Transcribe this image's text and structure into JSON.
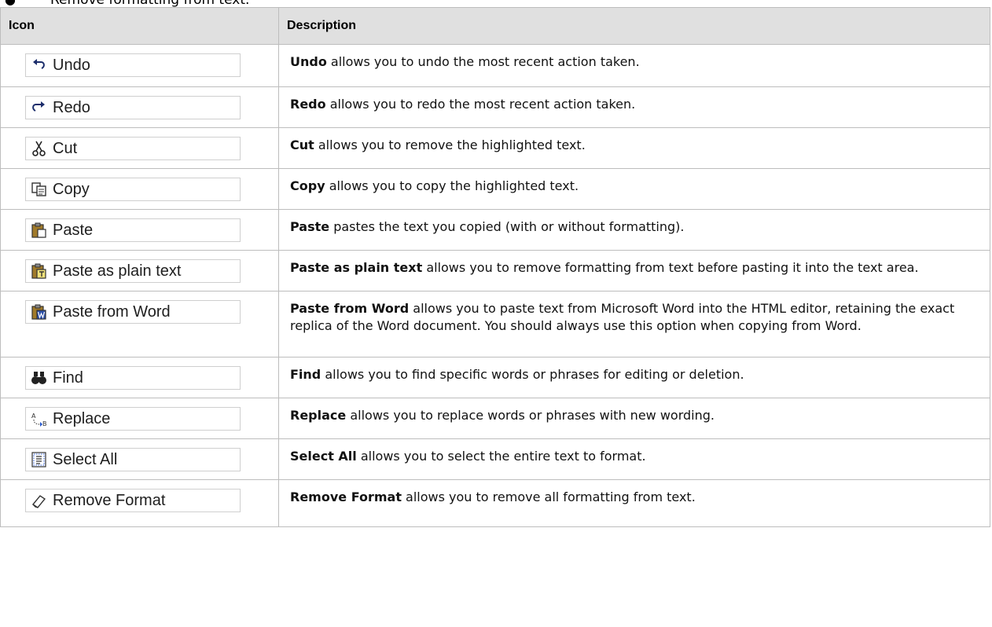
{
  "intro_bullet": "Remove formatting from text.",
  "table": {
    "headers": {
      "icon": "Icon",
      "description": "Description"
    },
    "rows": [
      {
        "button": "Undo",
        "icon": "undo-icon",
        "term": "Undo",
        "desc": " allows you to undo the most recent action taken."
      },
      {
        "button": "Redo",
        "icon": "redo-icon",
        "term": "Redo",
        "desc": " allows you to redo the most recent action taken."
      },
      {
        "button": "Cut",
        "icon": "scissors-icon",
        "term": "Cut",
        "desc": " allows you to remove the highlighted text."
      },
      {
        "button": "Copy",
        "icon": "copy-icon",
        "term": "Copy",
        "desc": " allows you to copy the highlighted text."
      },
      {
        "button": "Paste",
        "icon": "clipboard-icon",
        "term": "Paste",
        "desc": " pastes the text you copied (with or without formatting)."
      },
      {
        "button": "Paste as plain text",
        "icon": "paste-plain-text-icon",
        "term": "Paste as plain text",
        "desc": " allows you to remove formatting from text before pasting it into the text area."
      },
      {
        "button": "Paste from Word",
        "icon": "paste-from-word-icon",
        "term": "Paste from Word",
        "desc": " allows you to paste text from Microsoft Word into the HTML editor, retaining the exact replica of the Word document. You should always use this option when copying from Word."
      },
      {
        "button": "Find",
        "icon": "binoculars-icon",
        "term": "Find",
        "desc": " allows you to find specific words or phrases for editing or deletion."
      },
      {
        "button": "Replace",
        "icon": "replace-icon",
        "term": "Replace",
        "desc": " allows you to replace words or phrases with new wording."
      },
      {
        "button": "Select All",
        "icon": "select-all-icon",
        "term": "Select All",
        "desc": " allows you to select the entire text to format."
      },
      {
        "button": "Remove Format",
        "icon": "eraser-icon",
        "term": "Remove Format",
        "desc": " allows you to remove all formatting from text."
      }
    ]
  }
}
